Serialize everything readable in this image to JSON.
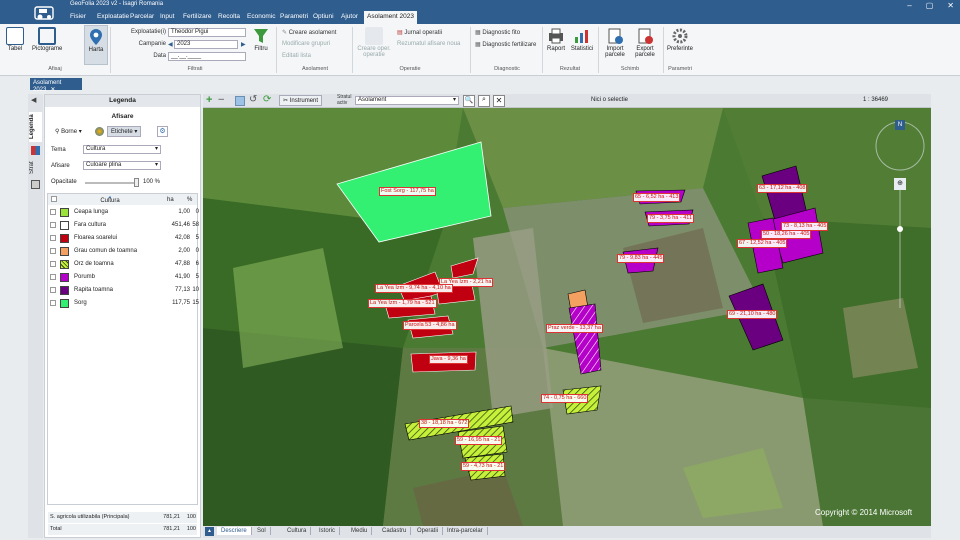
{
  "window": {
    "title": "GeoFolia 2023 v2 - Isagri Romania"
  },
  "menu": [
    "Fisier",
    "Exploatatie",
    "Parcelar",
    "Input",
    "Fertilizare",
    "Recolta",
    "Economic",
    "Parametri",
    "Optiuni",
    "Ajutor",
    "Asolament 2023"
  ],
  "ribbon": {
    "afisaj": {
      "label": "Afisaj",
      "tabel": "Tabel",
      "pictograme": "Pictograme",
      "harta": "Harta"
    },
    "filtrati": {
      "label": "Filtrati",
      "exploatatie_lbl": "Exploatatie(i)",
      "exploatatie_val": "Theodor Pigui",
      "campanie_lbl": "Campanie",
      "campanie_val": "2023",
      "data_lbl": "Data",
      "data_val": "__.__.____",
      "filtru": "Filtru"
    },
    "asolament": {
      "label": "Asolament",
      "creare": "Creare asolament",
      "btn2": "Modificare grupuri",
      "btn3": "Editati lista"
    },
    "operatie": {
      "label": "Operatie",
      "btn1": "Creare oper. operatie",
      "jurnal": "Jurnal operatii",
      "rezumat": "Rezumatul afisare noua"
    },
    "diagnostic": {
      "label": "Diagnostic",
      "fito": "Diagnostic fito",
      "fert": "Diagnostic fertilizare"
    },
    "rezultat": {
      "label": "Rezultat",
      "raport": "Raport",
      "statistici": "Statistici"
    },
    "schimb": {
      "label": "Schimb",
      "import": "Import parcele",
      "export": "Export parcele"
    },
    "parametri": {
      "label": "Parametri",
      "preferinte": "Preferinte"
    }
  },
  "doc_tab": "Asolament 2023",
  "side_tabs": [
    "Legenda",
    "Strat"
  ],
  "legend": {
    "title": "Legenda",
    "afisare": "Afisare",
    "borne": "Borne",
    "etichete": "Etichete",
    "tema_lbl": "Tema",
    "tema_val": "Cultura",
    "afisare_lbl": "Afisare",
    "afisare_val": "Culoare plina",
    "opacitate_lbl": "Opacitate",
    "opacitate_val": "100 %",
    "opacitate_level": 1.0,
    "columns": {
      "name": "Cultura",
      "ha": "ha",
      "pct": "%"
    },
    "rows": [
      {
        "name": "Ceapa lunga",
        "ha": "1,00",
        "pct": "0",
        "color": "#9be33a"
      },
      {
        "name": "Fara cultura",
        "ha": "451,46",
        "pct": "58",
        "color": "#ffffff"
      },
      {
        "name": "Floarea soarelui",
        "ha": "42,08",
        "pct": "5",
        "color": "#c00010"
      },
      {
        "name": "Grau comun de toamna",
        "ha": "2,00",
        "pct": "0",
        "color": "#f3a060"
      },
      {
        "name": "Orz de toamna",
        "ha": "47,88",
        "pct": "6",
        "color": "#c6f03a"
      },
      {
        "name": "Porumb",
        "ha": "41,90",
        "pct": "5",
        "color": "#b400c8"
      },
      {
        "name": "Rapita toamna",
        "ha": "77,13",
        "pct": "10",
        "color": "#6a0080"
      },
      {
        "name": "Sorg",
        "ha": "117,75",
        "pct": "15",
        "color": "#33f073"
      }
    ],
    "footer": [
      {
        "name": "S. agricola utilizabila (Principala)",
        "ha": "781,21",
        "pct": "100"
      },
      {
        "name": "Total",
        "ha": "781,21",
        "pct": "100"
      }
    ]
  },
  "map_toolbar": {
    "instrument": "Instrument",
    "strat_label": "Stratul activ",
    "strat_val": "Asolament",
    "selection": "Nici o selectie",
    "scale": "1 : 36469"
  },
  "map": {
    "copyright": "Copyright © 2014 Microsoft",
    "north": "N",
    "labels": [
      "Fost Sorg - 117,75 ha",
      "65 - 6,52 ha - 413",
      "79 - 3,75 ha - 411",
      "79 - 9,83 ha - 445",
      "63 - 17,12 ha - 408",
      "73 - 8,13 ha - 405",
      "50 - 18,26 ha - 405",
      "67 - 12,52 ha - 405",
      "69 - 21,10 ha - 480",
      "La Yea Izm - 2,21 ha",
      "La Yea Izm - 9,74 ha - 4,10 ha",
      "La Yea Izm - 1,79 ha - 521",
      "Parcela 53 - 4,86 ha",
      "Java - 9,36 ha",
      "Praz verde - 13,37 ha",
      "74 - 0,75 ha - 660",
      "38 - 18,18 ha - 672",
      "59 - 16,95 ha - 21",
      "59 - 4,73 ha - 21"
    ]
  },
  "bottom_tabs": [
    "Descriere",
    "Sol",
    "Cultura",
    "Istoric",
    "Mediu",
    "Cadastru",
    "Operatii",
    "Intra-parcelar"
  ]
}
